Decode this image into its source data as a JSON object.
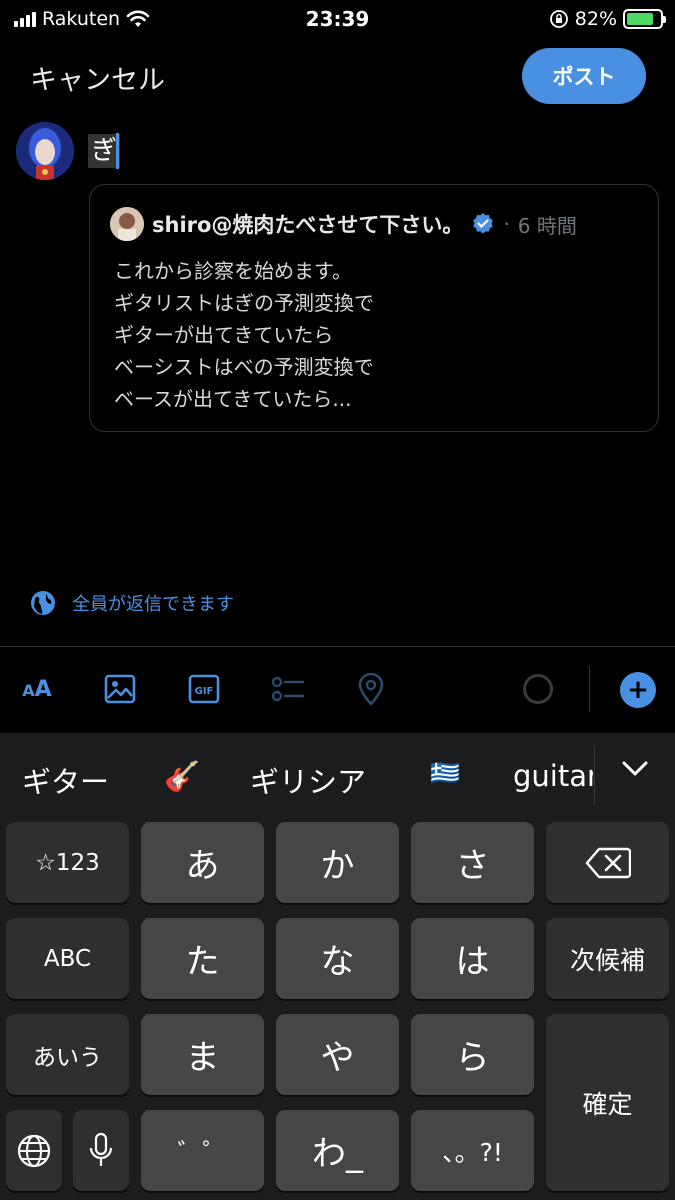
{
  "status_bar": {
    "carrier": "Rakuten",
    "time": "23:39",
    "battery": "82%",
    "battery_level": 0.82
  },
  "header": {
    "cancel_label": "キャンセル",
    "post_label": "ポスト"
  },
  "compose": {
    "text": "ぎ"
  },
  "quote": {
    "author": "shiro@焼肉たべさせて下さい。",
    "time": "6 時間",
    "lines": [
      "これから診察を始めます。",
      "ギタリストはぎの予測変換で",
      "ギターが出てきていたら",
      "ベーシストはべの予測変換で",
      "ベースが出てきていたら..."
    ]
  },
  "reply_setting": {
    "label": "全員が返信できます"
  },
  "toolbar": {
    "text_size_label": "AA",
    "icons": [
      "image-icon",
      "gif-icon",
      "poll-icon",
      "location-icon"
    ],
    "gif_label": "GIF"
  },
  "keyboard": {
    "candidates": [
      "ギター",
      "🎸",
      "ギリシア",
      "🇬🇷",
      "guitar"
    ],
    "keys": {
      "num": "☆123",
      "a": "あ",
      "ka": "か",
      "sa": "さ",
      "abc": "ABC",
      "ta": "た",
      "na": "な",
      "ha": "は",
      "next": "次候補",
      "aiu": "あいう",
      "ma": "ま",
      "ya": "や",
      "ra": "ら",
      "confirm": "確定",
      "dakuten": "゛゜",
      "wa": "わ_",
      "punct": "、。?!"
    }
  },
  "colors": {
    "accent": "#4a90e2",
    "background": "#000000",
    "keyboard_bg": "#1c1c1e",
    "key_light": "#464648",
    "key_dark": "#2f2f31"
  }
}
